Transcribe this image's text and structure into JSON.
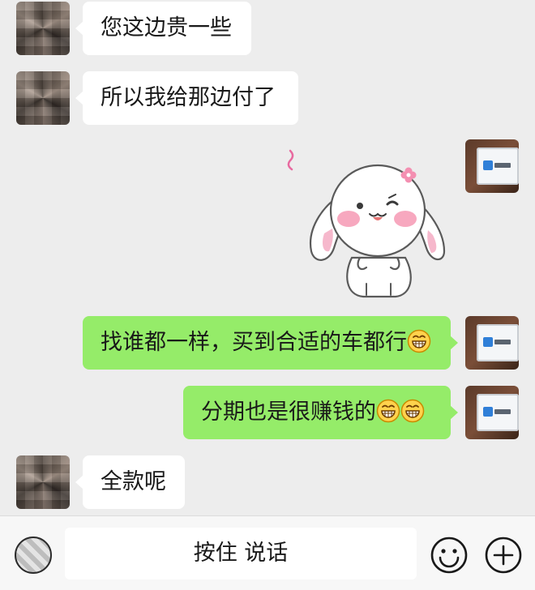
{
  "messages": [
    {
      "side": "peer",
      "text": "您这边贵一些"
    },
    {
      "side": "peer",
      "text": "所以我给那边付了"
    },
    {
      "side": "self",
      "type": "sticker",
      "sticker": "bunny-sticker"
    },
    {
      "side": "self",
      "text": "找谁都一样，买到合适的车都行",
      "emoji": [
        "grin-emoji"
      ]
    },
    {
      "side": "self",
      "text": "分期也是很赚钱的",
      "emoji": [
        "grin-emoji",
        "grin-emoji"
      ]
    },
    {
      "side": "peer",
      "text": "全款呢"
    }
  ],
  "input_bar": {
    "hold_to_talk_label": "按住 说话",
    "icons": [
      "voice-icon",
      "emoji-icon",
      "plus-icon"
    ]
  },
  "colors": {
    "background": "#ededed",
    "self_bubble": "#95ec69",
    "peer_bubble": "#ffffff",
    "input_bar": "#f7f7f7"
  }
}
